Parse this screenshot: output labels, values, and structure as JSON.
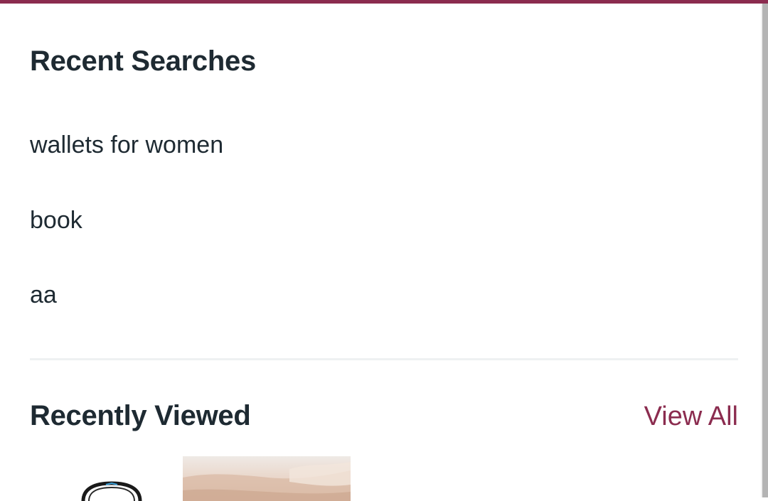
{
  "recent_searches": {
    "title": "Recent Searches",
    "items": [
      {
        "label": "wallets for women"
      },
      {
        "label": "book"
      },
      {
        "label": "aa"
      }
    ]
  },
  "recently_viewed": {
    "title": "Recently Viewed",
    "view_all_label": "View All",
    "products": [
      {
        "image": "watch-product-icon"
      },
      {
        "image": "fabric-product-photo"
      }
    ]
  },
  "colors": {
    "accent": "#8b2c4f",
    "text": "#1e2a32",
    "divider": "#eef1f2"
  }
}
